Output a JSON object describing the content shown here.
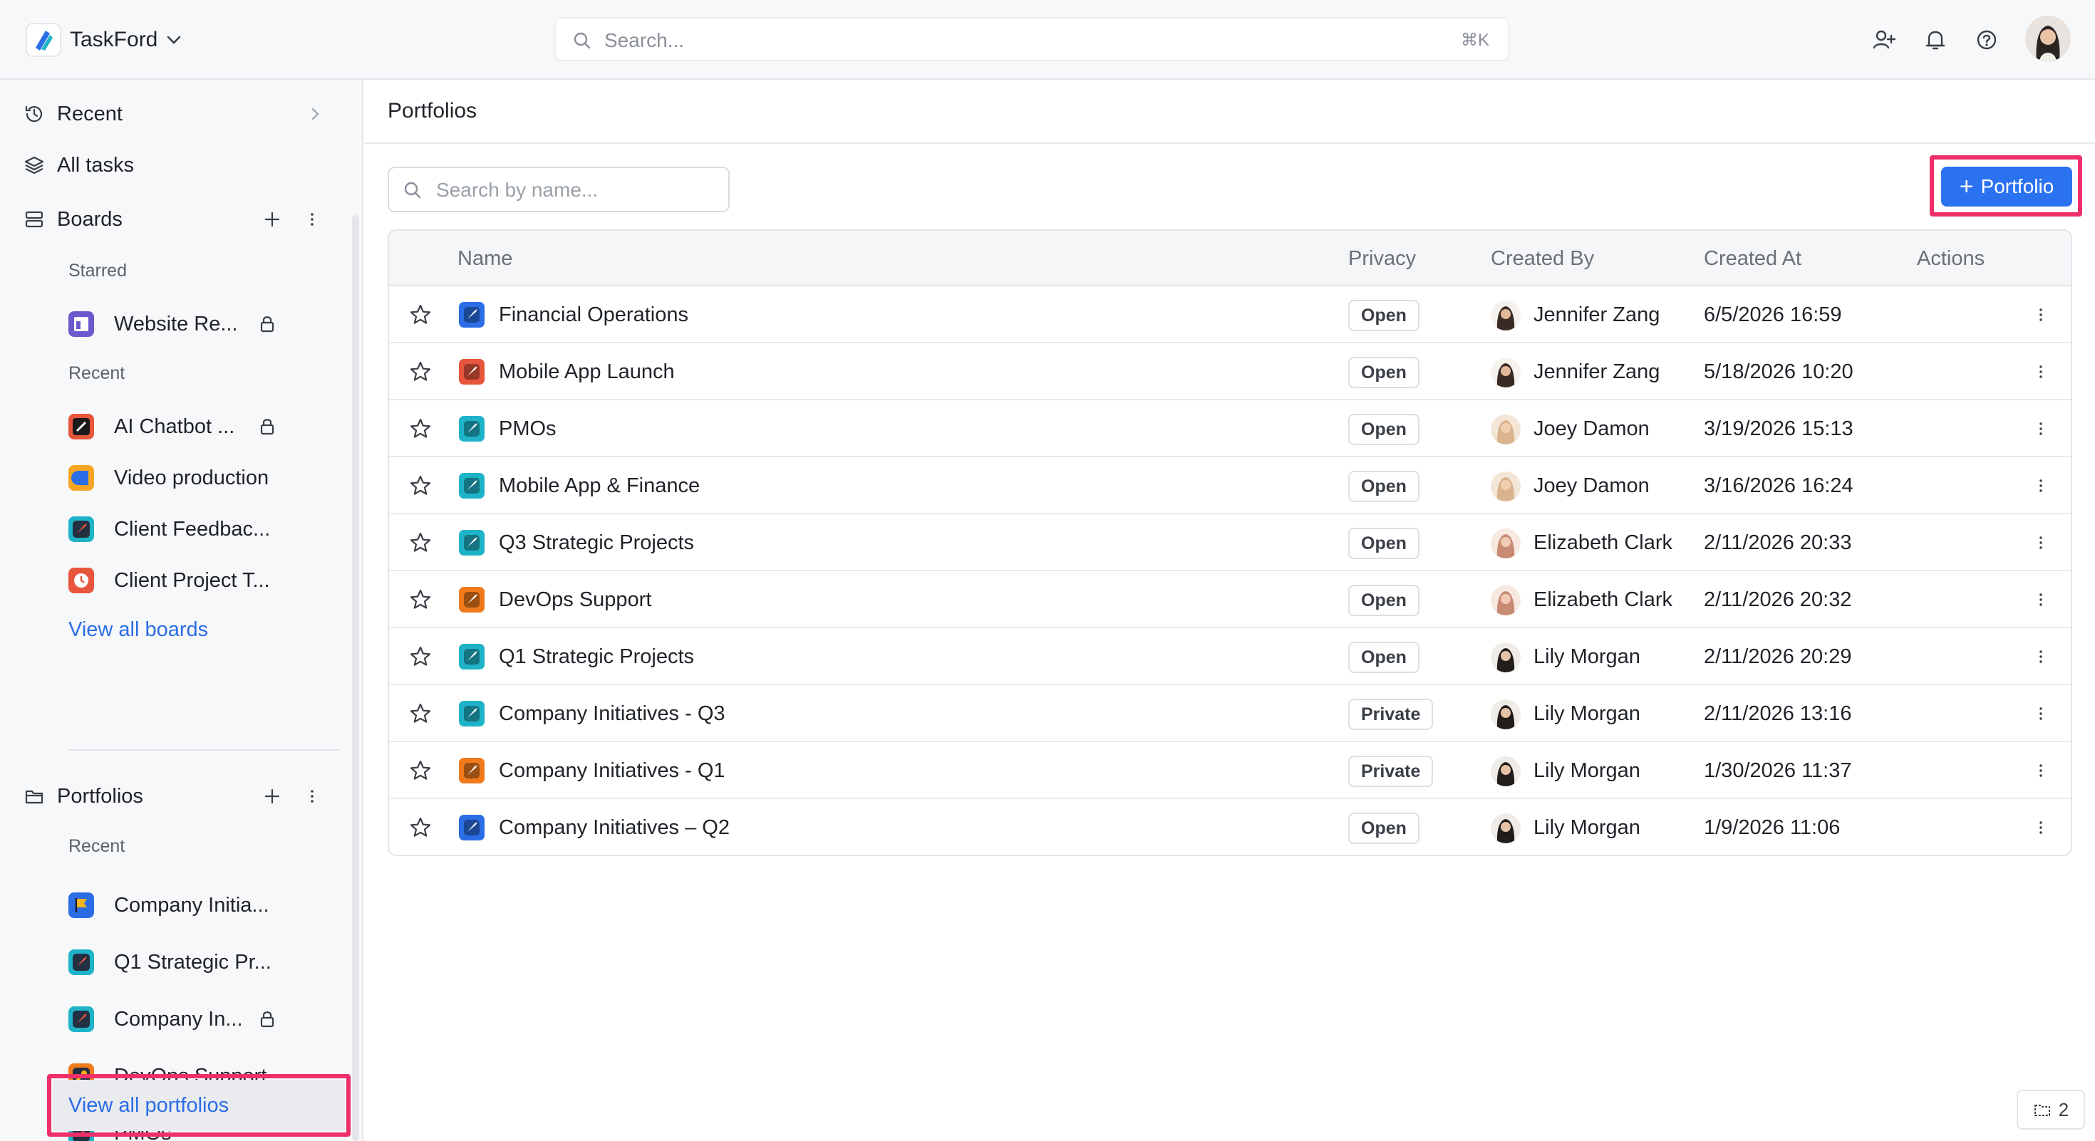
{
  "app": {
    "name": "TaskFord",
    "logo_icon": "taskford-logo-icon"
  },
  "search": {
    "placeholder": "Search...",
    "shortcut": "⌘K"
  },
  "sidebar": {
    "nav": [
      {
        "label": "Recent",
        "icon": "history-icon"
      },
      {
        "label": "All tasks",
        "icon": "layers-icon"
      },
      {
        "label": "Boards",
        "icon": "boards-icon"
      }
    ],
    "boards_starred_label": "Starred",
    "boards_starred": [
      {
        "label": "Website Re...",
        "color": "#6a5acd",
        "locked": true
      }
    ],
    "boards_recent_label": "Recent",
    "boards_recent": [
      {
        "label": "AI Chatbot ...",
        "color": "#e8553d",
        "locked": true
      },
      {
        "label": "Video production",
        "color": "#f5a623",
        "locked": false
      },
      {
        "label": "Client Feedbac...",
        "color": "#1fb3c7",
        "locked": false
      },
      {
        "label": "Client Project T...",
        "color": "#e8553d",
        "locked": false
      }
    ],
    "view_all_boards": "View all boards",
    "portfolios_label": "Portfolios",
    "portfolios_recent_label": "Recent",
    "portfolios_recent": [
      {
        "label": "Company Initia...",
        "color": "#2b6de5",
        "locked": false
      },
      {
        "label": "Q1 Strategic Pr...",
        "color": "#1fb3c7",
        "locked": false
      },
      {
        "label": "Company In...",
        "color": "#1fb3c7",
        "locked": true
      },
      {
        "label": "DevOps Support",
        "color": "#f07a1c",
        "locked": false
      },
      {
        "label": "PMOs",
        "color": "#1fb3c7",
        "locked": false
      }
    ],
    "view_all_portfolios": "View all portfolios"
  },
  "main": {
    "title": "Portfolios",
    "search_placeholder": "Search by name...",
    "add_button": "Portfolio",
    "columns": {
      "name": "Name",
      "privacy": "Privacy",
      "created_by": "Created By",
      "created_at": "Created At",
      "actions": "Actions"
    },
    "rows": [
      {
        "name": "Financial Operations",
        "privacy": "Open",
        "created_by": "Jennifer Zang",
        "created_at": "6/5/2026 16:59",
        "icon_color": "#2b6de5"
      },
      {
        "name": "Mobile App Launch",
        "privacy": "Open",
        "created_by": "Jennifer Zang",
        "created_at": "5/18/2026 10:20",
        "icon_color": "#e8553d"
      },
      {
        "name": "PMOs",
        "privacy": "Open",
        "created_by": "Joey Damon",
        "created_at": "3/19/2026 15:13",
        "icon_color": "#1fb3c7"
      },
      {
        "name": "Mobile App & Finance",
        "privacy": "Open",
        "created_by": "Joey Damon",
        "created_at": "3/16/2026 16:24",
        "icon_color": "#1fb3c7"
      },
      {
        "name": "Q3 Strategic Projects",
        "privacy": "Open",
        "created_by": "Elizabeth Clark",
        "created_at": "2/11/2026 20:33",
        "icon_color": "#1fb3c7"
      },
      {
        "name": "DevOps Support",
        "privacy": "Open",
        "created_by": "Elizabeth Clark",
        "created_at": "2/11/2026 20:32",
        "icon_color": "#f07a1c"
      },
      {
        "name": "Q1 Strategic Projects",
        "privacy": "Open",
        "created_by": "Lily Morgan",
        "created_at": "2/11/2026 20:29",
        "icon_color": "#1fb3c7"
      },
      {
        "name": "Company Initiatives - Q3",
        "privacy": "Private",
        "created_by": "Lily Morgan",
        "created_at": "2/11/2026 13:16",
        "icon_color": "#1fb3c7"
      },
      {
        "name": "Company Initiatives - Q1",
        "privacy": "Private",
        "created_by": "Lily Morgan",
        "created_at": "1/30/2026 11:37",
        "icon_color": "#f07a1c"
      },
      {
        "name": "Company Initiatives – Q2",
        "privacy": "Open",
        "created_by": "Lily Morgan",
        "created_at": "1/9/2026 11:06",
        "icon_color": "#2b6de5"
      }
    ]
  },
  "corner_widget": {
    "count": "2"
  },
  "colors": {
    "accent": "#2b72f0",
    "highlight": "#ef2f6a",
    "link": "#2b6de5"
  }
}
